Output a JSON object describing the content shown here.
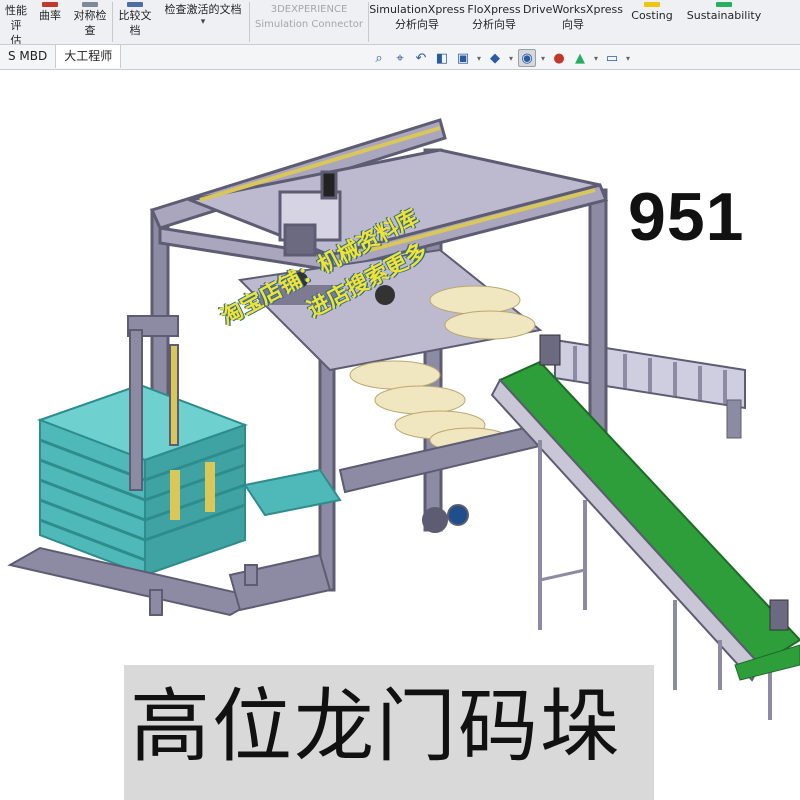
{
  "ribbon": {
    "items": [
      {
        "label": "性能评\n估",
        "icon_color": "#3a7bd5"
      },
      {
        "label": "曲率",
        "icon_color": "#c0392b"
      },
      {
        "label": "对称检\n查",
        "icon_color": "#7d8a99"
      },
      {
        "label": "比较文\n档",
        "icon_color": "#4a6fa5"
      },
      {
        "label": "检查激活的文档",
        "icon_color": "#5b6b7c"
      },
      {
        "label": "3DEXPERIENCE\nSimulation Connector",
        "icon_color": "#b8bcc2"
      },
      {
        "label": "SimulationXpress\n分析向导",
        "icon_color": "#2e86c1"
      },
      {
        "label": "FloXpress\n分析向导",
        "icon_color": "#1abc9c"
      },
      {
        "label": "DriveWorksXpress\n向导",
        "icon_color": "#e67e22"
      },
      {
        "label": "Costing",
        "icon_color": "#f1c40f"
      },
      {
        "label": "Sustainability",
        "icon_color": "#27ae60"
      }
    ]
  },
  "tabs": [
    {
      "label": "S MBD"
    },
    {
      "label": "大工程师"
    }
  ],
  "hud": {
    "icons": [
      "zoom-fit-icon",
      "zoom-area-icon",
      "previous-view-icon",
      "section-view-icon",
      "view-orientation-icon",
      "display-style-icon",
      "hide-show-icon",
      "edit-appearance-icon",
      "apply-scene-icon",
      "view-settings-icon"
    ]
  },
  "model_number": "951",
  "watermark": {
    "line1": "淘宝店铺：机械资料库",
    "line2": "进店搜索更多"
  },
  "title": "高位龙门码垛",
  "colors": {
    "frame": "#8d8aa3",
    "frame_dark": "#5e5c72",
    "pallet": "#4fb8b8",
    "pallet_dark": "#2f8c8c",
    "conveyor_belt": "#2e9e3a",
    "bag": "#f0e6c0",
    "rail": "#d9c75a",
    "title_bg": "#d9d9d9"
  }
}
